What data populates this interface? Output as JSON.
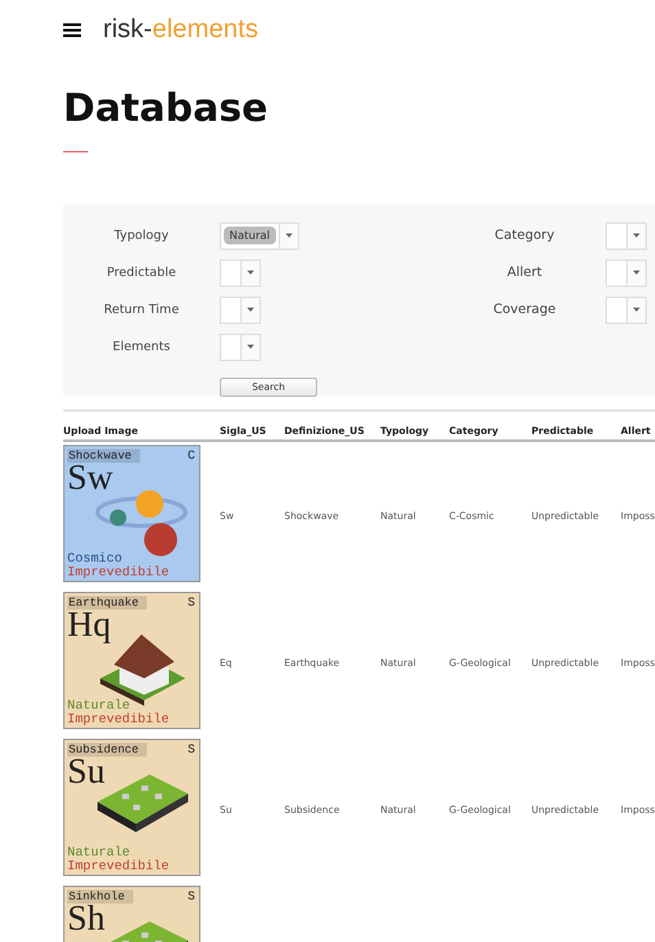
{
  "header": {
    "brand_part_1": "risk-",
    "brand_part_2": "elements"
  },
  "page_title": "Database",
  "filters": {
    "left": [
      {
        "label": "Typology",
        "value": "Natural"
      },
      {
        "label": "Predictable"
      },
      {
        "label": "Return Time"
      },
      {
        "label": "Elements"
      }
    ],
    "right": [
      {
        "label": "Category"
      },
      {
        "label": "Allert"
      },
      {
        "label": "Coverage"
      }
    ],
    "search_button": "Search"
  },
  "table": {
    "columns": [
      "Upload Image",
      "Sigla_US",
      "Definizione_US",
      "Typology",
      "Category",
      "Predictable",
      "Allert"
    ],
    "rows": [
      {
        "card": {
          "name": "Shockwave",
          "class": "C",
          "symbol": "Sw",
          "line_1": "Cosmico",
          "line_2": "Imprevedibile",
          "color": "#a9c9ee",
          "kind": "cosmic"
        },
        "cells": [
          "Sw",
          "Shockwave",
          "Natural",
          "C-Cosmic",
          "Unpredictable",
          "Imposs"
        ]
      },
      {
        "card": {
          "name": "Earthquake",
          "class": "S",
          "symbol": "Hq",
          "line_1": "Naturale",
          "line_2": "Imprevedibile",
          "color": "#efd9b4",
          "kind": "house"
        },
        "cells": [
          "Eq",
          "Earthquake",
          "Natural",
          "G-Geological",
          "Unpredictable",
          "Imposs"
        ]
      },
      {
        "card": {
          "name": "Subsidence",
          "class": "S",
          "symbol": "Su",
          "line_1": "Naturale",
          "line_2": "Imprevedibile",
          "color": "#efd9b4",
          "kind": "ground"
        },
        "cells": [
          "Su",
          "Subsidence",
          "Natural",
          "G-Geological",
          "Unpredictable",
          "Imposs"
        ]
      },
      {
        "card": {
          "name": "Sinkhole",
          "class": "S",
          "symbol": "Sh",
          "color": "#efd9b4",
          "kind": "ground"
        }
      }
    ]
  }
}
